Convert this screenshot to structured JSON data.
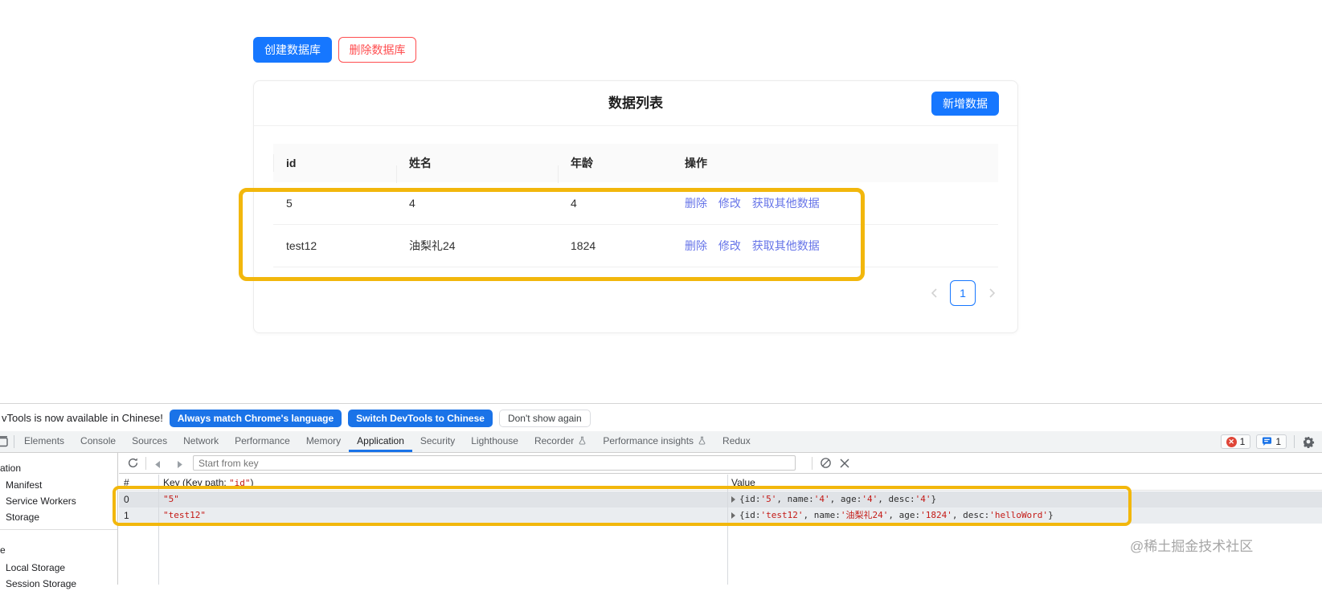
{
  "app": {
    "buttons": {
      "create": "创建数据库",
      "delete": "删除数据库"
    },
    "card": {
      "title": "数据列表",
      "add_button": "新增数据",
      "table": {
        "headers": [
          "id",
          "姓名",
          "年龄",
          "操作"
        ],
        "rows": [
          {
            "id": "5",
            "name": "4",
            "age": "4",
            "actions": [
              "删除",
              "修改",
              "获取其他数据"
            ]
          },
          {
            "id": "test12",
            "name": "油梨礼24",
            "age": "1824",
            "actions": [
              "删除",
              "修改",
              "获取其他数据"
            ]
          }
        ]
      },
      "pagination": {
        "current_page": "1"
      }
    }
  },
  "devtools": {
    "infobar": {
      "message": "vTools is now available in Chinese!",
      "match_language_button": "Always match Chrome's language",
      "switch_button": "Switch DevTools to Chinese",
      "dismiss_button": "Don't show again"
    },
    "tabs": [
      "Elements",
      "Console",
      "Sources",
      "Network",
      "Performance",
      "Memory",
      "Application",
      "Security",
      "Lighthouse",
      "Recorder",
      "Performance insights",
      "Redux"
    ],
    "active_tab": "Application",
    "error_count": "1",
    "message_count": "1",
    "sidebar": {
      "section_truncated": "ation",
      "item_manifest": "Manifest",
      "item_service_workers": "Service Workers",
      "item_storage": "Storage",
      "section2_truncated": "e",
      "item_local_storage": "Local Storage",
      "item_session_storage": "Session Storage"
    },
    "toolbar": {
      "placeholder": "Start from key"
    },
    "grid": {
      "index_header": "#",
      "key_header_prefix": "Key (Key path: ",
      "key_path": "\"id\"",
      "key_header_suffix": ")",
      "value_header": "Value",
      "rows": [
        {
          "index": "0",
          "key": "\"5\"",
          "value_tokens": [
            "{id: ",
            "'5'",
            ", name: ",
            "'4'",
            ", age: ",
            "'4'",
            ", desc: ",
            "'4'",
            "}"
          ]
        },
        {
          "index": "1",
          "key": "\"test12\"",
          "value_tokens": [
            "{id: ",
            "'test12'",
            ", name: ",
            "'油梨礼24'",
            ", age: ",
            "'1824'",
            ", desc: ",
            "'helloWord'",
            "}"
          ]
        }
      ]
    }
  },
  "watermark": "@稀土掘金技术社区"
}
